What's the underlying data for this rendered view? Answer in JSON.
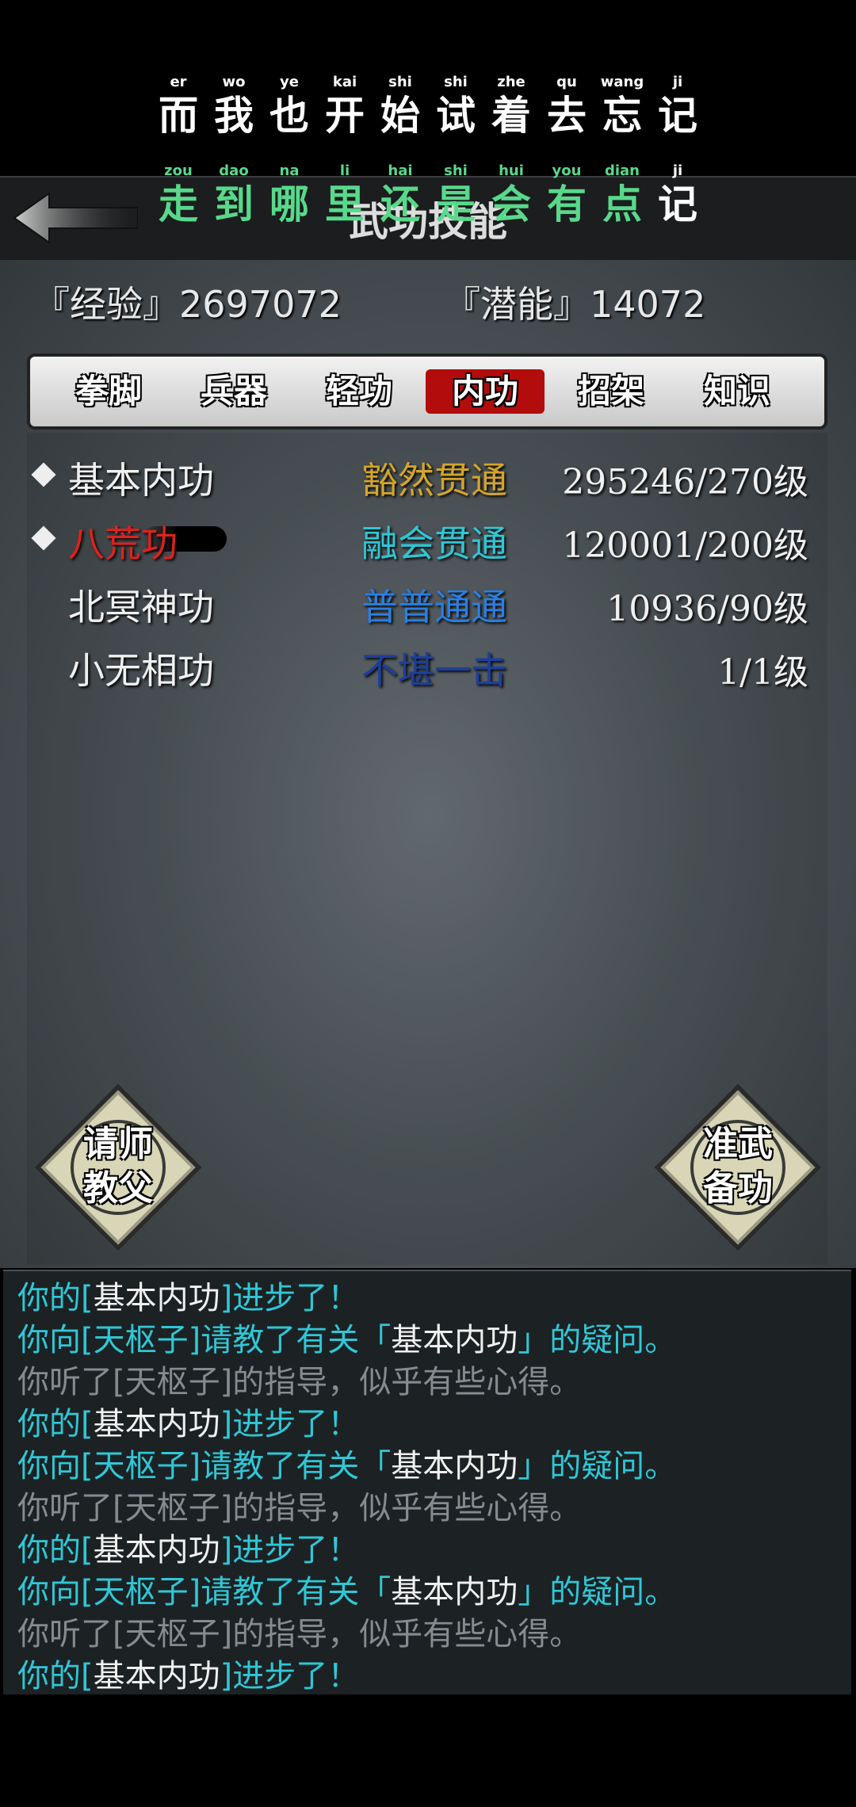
{
  "lyrics": {
    "line1": [
      {
        "char": "而",
        "pinyin": "er"
      },
      {
        "char": "我",
        "pinyin": "wo"
      },
      {
        "char": "也",
        "pinyin": "ye"
      },
      {
        "char": "开",
        "pinyin": "kai"
      },
      {
        "char": "始",
        "pinyin": "shi"
      },
      {
        "char": "试",
        "pinyin": "shi"
      },
      {
        "char": "着",
        "pinyin": "zhe"
      },
      {
        "char": "去",
        "pinyin": "qu"
      },
      {
        "char": "忘",
        "pinyin": "wang"
      },
      {
        "char": "记",
        "pinyin": "ji"
      }
    ],
    "line2": [
      {
        "char": "走",
        "pinyin": "zou"
      },
      {
        "char": "到",
        "pinyin": "dao"
      },
      {
        "char": "哪",
        "pinyin": "na"
      },
      {
        "char": "里",
        "pinyin": "li"
      },
      {
        "char": "还",
        "pinyin": "hai"
      },
      {
        "char": "是",
        "pinyin": "shi"
      },
      {
        "char": "会",
        "pinyin": "hui"
      },
      {
        "char": "有",
        "pinyin": "you"
      },
      {
        "char": "点",
        "pinyin": "dian"
      },
      {
        "char": "记",
        "pinyin": "ji"
      }
    ]
  },
  "header": {
    "title": "武功技能",
    "back_icon": "back-arrow-icon"
  },
  "stats": {
    "exp_label": "『经验』",
    "exp_value": "2697072",
    "pot_label": "『潜能』",
    "pot_value": "14072"
  },
  "tabs": [
    {
      "label": "拳脚",
      "active": false
    },
    {
      "label": "兵器",
      "active": false
    },
    {
      "label": "轻功",
      "active": false
    },
    {
      "label": "内功",
      "active": true
    },
    {
      "label": "招架",
      "active": false
    },
    {
      "label": "知识",
      "active": false
    }
  ],
  "skills": [
    {
      "name": "基本内功",
      "marked": true,
      "level": "豁然贯通",
      "level_color": "#d4a52a",
      "progress": "295246/270级",
      "name_color": "#f0f0f0"
    },
    {
      "name": "八荒功",
      "marked": true,
      "level": "融会贯通",
      "level_color": "#2fc7d6",
      "progress": "120001/200级",
      "name_color": "#e0211c"
    },
    {
      "name": "北冥神功",
      "marked": false,
      "level": "普普通通",
      "level_color": "#2b7fe0",
      "progress": "10936/90级",
      "name_color": "#f0f0f0"
    },
    {
      "name": "小无相功",
      "marked": false,
      "level": "不堪一击",
      "level_color": "#1d3f9a",
      "progress": "1/1级",
      "name_color": "#f0f0f0"
    }
  ],
  "buttons": {
    "ask_master": "请师\n教父",
    "prepare": "准武\n备功"
  },
  "log": [
    {
      "parts": [
        [
          "你的[",
          "cyan"
        ],
        [
          "基本内功",
          "white"
        ],
        [
          "]进步了！",
          "cyan"
        ]
      ]
    },
    {
      "parts": [
        [
          "你向[天枢子]请教了有关「",
          "cyan"
        ],
        [
          "基本内功",
          "white"
        ],
        [
          "」的疑问。",
          "cyan"
        ]
      ]
    },
    {
      "parts": [
        [
          "你听了[天枢子]的指导，似乎有些心得。",
          "gray"
        ]
      ]
    },
    {
      "parts": [
        [
          "你的[",
          "cyan"
        ],
        [
          "基本内功",
          "white"
        ],
        [
          "]进步了！",
          "cyan"
        ]
      ]
    },
    {
      "parts": [
        [
          "你向[天枢子]请教了有关「",
          "cyan"
        ],
        [
          "基本内功",
          "white"
        ],
        [
          "」的疑问。",
          "cyan"
        ]
      ]
    },
    {
      "parts": [
        [
          "你听了[天枢子]的指导，似乎有些心得。",
          "gray"
        ]
      ]
    },
    {
      "parts": [
        [
          "你的[",
          "cyan"
        ],
        [
          "基本内功",
          "white"
        ],
        [
          "]进步了！",
          "cyan"
        ]
      ]
    },
    {
      "parts": [
        [
          "你向[天枢子]请教了有关「",
          "cyan"
        ],
        [
          "基本内功",
          "white"
        ],
        [
          "」的疑问。",
          "cyan"
        ]
      ]
    },
    {
      "parts": [
        [
          "你听了[天枢子]的指导，似乎有些心得。",
          "gray"
        ]
      ]
    },
    {
      "parts": [
        [
          "你的[",
          "cyan"
        ],
        [
          "基本内功",
          "white"
        ],
        [
          "]进步了！",
          "cyan"
        ]
      ]
    }
  ]
}
